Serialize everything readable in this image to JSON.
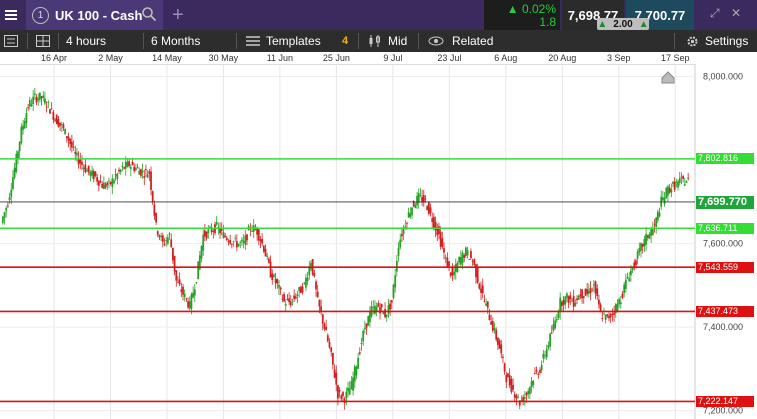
{
  "header": {
    "menu_icon": "hamburger-icon",
    "tab_number": "1",
    "instrument": "UK 100 - Cash",
    "change_pct": "0.02%",
    "change_pts": "1.8",
    "sell_price": "7,698.77",
    "spread": "2.00",
    "buy_price": "7,700.77",
    "up_color": "#28c840"
  },
  "toolbar": {
    "interval": "4 hours",
    "range": "6 Months",
    "templates_label": "Templates",
    "templates_count": "4",
    "price_mode": "Mid",
    "related_label": "Related",
    "settings_label": "Settings"
  },
  "chart_data": {
    "type": "candlestick",
    "x_tick_labels": [
      "16 Apr",
      "2 May",
      "14 May",
      "30 May",
      "11 Jun",
      "25 Jun",
      "9 Jul",
      "23 Jul",
      "6 Aug",
      "20 Aug",
      "3 Sep",
      "17 Sep"
    ],
    "y_tick_labels": [
      "8,000.000",
      "7,600.000",
      "7,400.000",
      "7,200.000"
    ],
    "y_ticks": [
      8000,
      7600,
      7400,
      7200
    ],
    "ylim": [
      7180,
      8030
    ],
    "current_price": 7699.77,
    "current_price_label": "7,699.770",
    "up_color": "#28a028",
    "down_color": "#d02020",
    "support_resistance": [
      {
        "value": 7802.816,
        "label": "7,802.816",
        "color": "#33dd33"
      },
      {
        "value": 7636.711,
        "label": "7,636.711",
        "color": "#33dd33"
      },
      {
        "value": 7543.559,
        "label": "7,543.559",
        "color": "#dd1111"
      },
      {
        "value": 7437.473,
        "label": "7,437.473",
        "color": "#dd1111"
      },
      {
        "value": 7222.147,
        "label": "7,222.147",
        "color": "#dd1111"
      }
    ],
    "series": [
      {
        "values": [
          7650,
          7700,
          7780,
          7870,
          7930,
          7950,
          7950,
          7930,
          7900,
          7880,
          7850,
          7810,
          7790,
          7770,
          7760,
          7740,
          7740,
          7760,
          7780,
          7790,
          7780,
          7770,
          7770,
          7640,
          7600,
          7620,
          7510,
          7480,
          7450,
          7520,
          7620,
          7630,
          7640,
          7620,
          7610,
          7600,
          7600,
          7640,
          7630,
          7590,
          7530,
          7500,
          7460,
          7460,
          7480,
          7500,
          7560,
          7460,
          7400,
          7330,
          7240,
          7230,
          7260,
          7330,
          7400,
          7440,
          7450,
          7430,
          7460,
          7600,
          7650,
          7690,
          7710,
          7700,
          7660,
          7620,
          7560,
          7520,
          7560,
          7580,
          7560,
          7500,
          7450,
          7400,
          7350,
          7280,
          7250,
          7220,
          7240,
          7280,
          7300,
          7350,
          7400,
          7460,
          7470,
          7460,
          7480,
          7480,
          7500,
          7430,
          7420,
          7440,
          7470,
          7520,
          7550,
          7590,
          7620,
          7640,
          7700,
          7730,
          7740,
          7750
        ]
      }
    ]
  }
}
